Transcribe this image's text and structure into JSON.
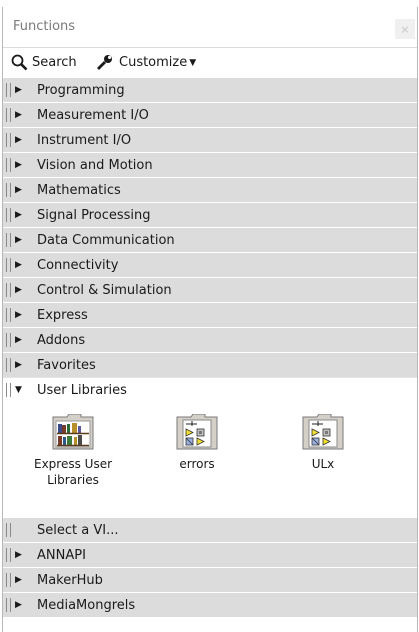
{
  "window": {
    "title": "Functions",
    "close_glyph": "×"
  },
  "toolbar": {
    "search_label": "Search",
    "customize_label": "Customize"
  },
  "categories_top": [
    {
      "label": "Programming"
    },
    {
      "label": "Measurement I/O"
    },
    {
      "label": "Instrument I/O"
    },
    {
      "label": "Vision and Motion"
    },
    {
      "label": "Mathematics"
    },
    {
      "label": "Signal Processing"
    },
    {
      "label": "Data Communication"
    },
    {
      "label": "Connectivity"
    },
    {
      "label": "Control & Simulation"
    },
    {
      "label": "Express"
    },
    {
      "label": "Addons"
    },
    {
      "label": "Favorites"
    }
  ],
  "expanded_category": {
    "label": "User Libraries",
    "items": [
      {
        "label": "Express User Libraries",
        "icon": "books-icon"
      },
      {
        "label": "errors",
        "icon": "vi-folder-icon"
      },
      {
        "label": "ULx",
        "icon": "vi-folder-icon"
      }
    ]
  },
  "select_vi_label": "Select a VI...",
  "categories_bottom": [
    {
      "label": "ANNAPI"
    },
    {
      "label": "MakerHub"
    },
    {
      "label": "MediaMongrels"
    }
  ],
  "colors": {
    "row_bg": "#dcdcdc",
    "panel_bg": "#ffffff",
    "text": "#1a1a1a"
  }
}
